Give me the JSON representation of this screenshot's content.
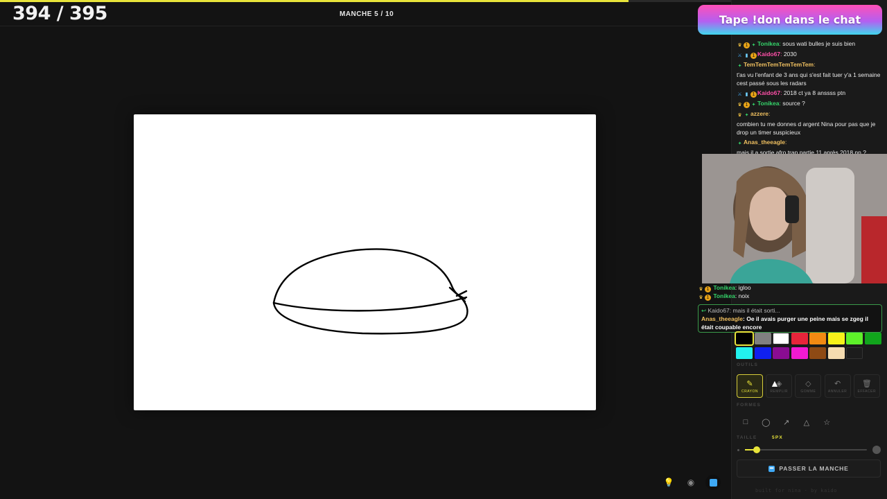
{
  "game": {
    "counter": "394 / 395",
    "round": "MANCHE 5 / 10",
    "progress_fraction": 0.86,
    "accent_color": "#e8e43a"
  },
  "banner": {
    "text": "Tape !don dans le chat"
  },
  "chat": {
    "messages": [
      {
        "badges": [
          "crown-icon",
          "gold-badge",
          "green-badge"
        ],
        "user": "Tonikea",
        "user_color": "#35d46a",
        "text": " sous wati bulles je suis bien"
      },
      {
        "badges": [
          "sword-icon",
          "bar-badge",
          "gold-badge"
        ],
        "user": "Kaido67",
        "user_color": "#ff4fa8",
        "text": " 2030"
      },
      {
        "badges": [
          "green-badge"
        ],
        "user": "TemTemTemTemTemTem",
        "user_color": "#f0c060",
        "text": ""
      },
      {
        "badges": [],
        "user": "",
        "user_color": "#eaeaea",
        "text": "t'as vu l'enfant de 3 ans qui s'est fait tuer y'a 1 semaine cest passé sous les radars"
      },
      {
        "badges": [
          "sword-icon",
          "bar-badge",
          "gold-badge"
        ],
        "user": "Kaido67",
        "user_color": "#ff4fa8",
        "text": " 2018 ct ya 8 anssss ptn"
      },
      {
        "badges": [
          "crown-icon",
          "gold-badge",
          "green-badge"
        ],
        "user": "Tonikea",
        "user_color": "#35d46a",
        "text": " source ?"
      },
      {
        "badges": [
          "crown-icon",
          "green-badge"
        ],
        "user": "azzere",
        "user_color": "#f0c060",
        "text": ""
      },
      {
        "badges": [],
        "user": "",
        "user_color": "#eaeaea",
        "text": "combien tu me donnes d argent Nina pour pas que je drop un timer suspicieux"
      },
      {
        "badges": [
          "green-badge"
        ],
        "user": "Anas_theeagle",
        "user_color": "#f0c060",
        "text": ""
      },
      {
        "badges": [],
        "user": "",
        "user_color": "#eaeaea",
        "text": "mais il a sortie afro trap partie 11 après 2018 nn ?"
      }
    ],
    "overlay_lines": [
      {
        "user": "Tonikea",
        "text": " igloo"
      },
      {
        "user": "Tonikea",
        "text": " noix"
      }
    ],
    "overlay_ghost": "Anas_theeagle:",
    "overlay_ghost_text": "Oe il avais purger une peine mais se zgeg il était coupable encore",
    "reply": {
      "top_user": "Kaido67",
      "top_text": " mais il était sorti...",
      "main_user": "Anas_theeagle",
      "main_text": "Oe il avais purger une peine mais se zgeg il était coupable encore"
    }
  },
  "palette": {
    "colors": [
      "#000000",
      "#808080",
      "#ffffff",
      "#e8253a",
      "#f28a12",
      "#f6f21a",
      "#5ef02a",
      "#11a51c",
      "#22f2ee",
      "#1020f0",
      "#8a0c92",
      "#f21ad2",
      "#8e4a14",
      "#f5dcb0",
      "#1c1c1c"
    ],
    "selected_index": 0
  },
  "tools": {
    "section_label": "OUTILS",
    "items": [
      {
        "label": "CRAYON",
        "icon": "pencil-icon",
        "glyph": "✎",
        "active": true
      },
      {
        "label": "REMPLIR",
        "icon": "bucket-icon",
        "glyph": "◈",
        "active": false
      },
      {
        "label": "GOMME",
        "icon": "eraser-icon",
        "glyph": "◇",
        "active": false
      },
      {
        "label": "ANNULER",
        "icon": "undo-icon",
        "glyph": "↶",
        "active": false
      },
      {
        "label": "EFFACER",
        "icon": "trash-icon",
        "glyph": "🗑",
        "active": false
      }
    ]
  },
  "shapes": {
    "section_label": "FORMES",
    "items": [
      {
        "icon": "rectangle-icon",
        "glyph": "□"
      },
      {
        "icon": "ellipse-icon",
        "glyph": "◯"
      },
      {
        "icon": "arrow-icon",
        "glyph": "↗"
      },
      {
        "icon": "triangle-icon",
        "glyph": "△"
      },
      {
        "icon": "star-icon",
        "glyph": "☆"
      }
    ]
  },
  "size": {
    "section_label": "TAILLE",
    "value_label": "5PX",
    "slider_fraction": 0.1
  },
  "pass_button": {
    "label": "PASSER LA MANCHE"
  },
  "footer": {
    "text": "built for nina · by kaido"
  }
}
